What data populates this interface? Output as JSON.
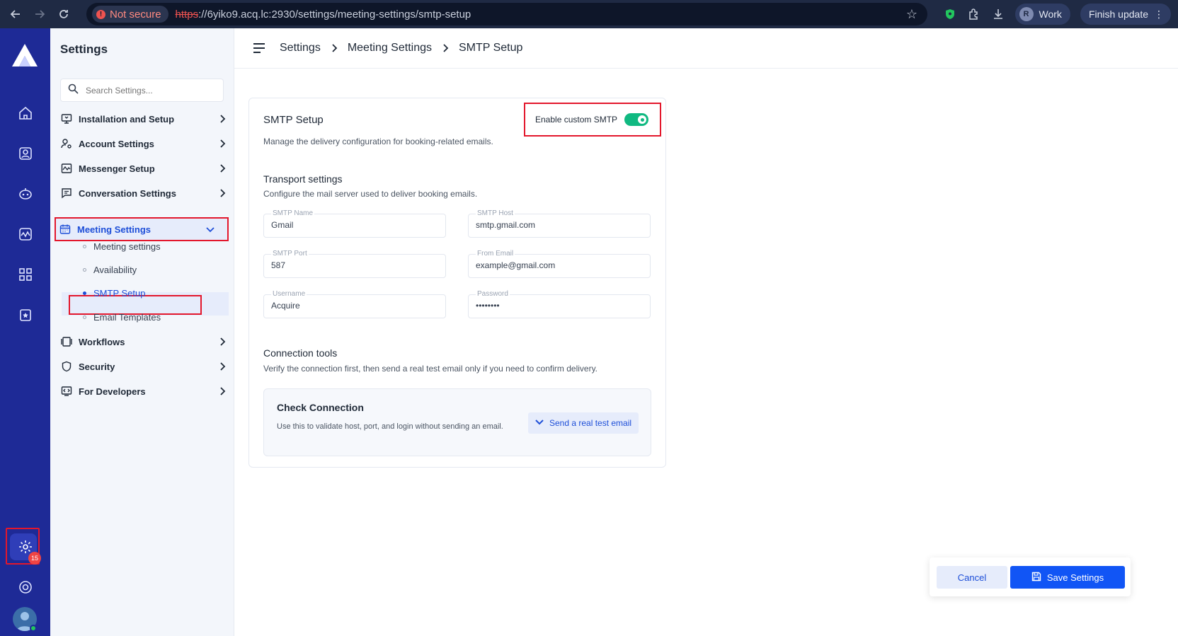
{
  "browser": {
    "security_label": "Not secure",
    "url_scheme": "https",
    "url_rest": "://6yiko9.acq.lc:2930/settings/meeting-settings/smtp-setup",
    "profile_initial": "R",
    "profile_label": "Work",
    "update_label": "Finish update"
  },
  "rail": {
    "notification_count": "15"
  },
  "sidebar": {
    "title": "Settings",
    "search_placeholder": "Search Settings...",
    "items": [
      {
        "label": "Installation and Setup"
      },
      {
        "label": "Account Settings"
      },
      {
        "label": "Messenger Setup"
      },
      {
        "label": "Conversation Settings"
      },
      {
        "label": "Meeting Settings"
      },
      {
        "label": "Workflows"
      },
      {
        "label": "Security"
      },
      {
        "label": "For Developers"
      }
    ],
    "sub_items": [
      {
        "label": "Meeting settings"
      },
      {
        "label": "Availability"
      },
      {
        "label": "SMTP Setup"
      },
      {
        "label": "Email Templates"
      }
    ]
  },
  "breadcrumb": [
    "Settings",
    "Meeting Settings",
    "SMTP Setup"
  ],
  "card": {
    "title": "SMTP Setup",
    "description": "Manage the delivery configuration for booking-related emails.",
    "toggle_label": "Enable custom SMTP",
    "transport_title": "Transport settings",
    "transport_desc": "Configure the mail server used to deliver booking emails.",
    "fields": {
      "smtp_name": {
        "label": "SMTP Name",
        "value": "Gmail"
      },
      "smtp_host": {
        "label": "SMTP Host",
        "value": "smtp.gmail.com"
      },
      "smtp_port": {
        "label": "SMTP Port",
        "value": "587"
      },
      "from_email": {
        "label": "From Email",
        "value": "example@gmail.com"
      },
      "username": {
        "label": "Username",
        "value": "Acquire"
      },
      "password": {
        "label": "Password",
        "value": "••••••••"
      }
    },
    "tools_title": "Connection tools",
    "tools_desc": "Verify the connection first, then send a real test email only if you need to confirm delivery.",
    "check_title": "Check Connection",
    "check_desc": "Use this to validate host, port, and login without sending an email.",
    "test_button": "Send a real test email"
  },
  "actions": {
    "cancel": "Cancel",
    "save": "Save Settings"
  },
  "colors": {
    "rail": "#1e2a96",
    "accent": "#1155f5",
    "toggle_on": "#10b981",
    "highlight": "#e3172c"
  }
}
